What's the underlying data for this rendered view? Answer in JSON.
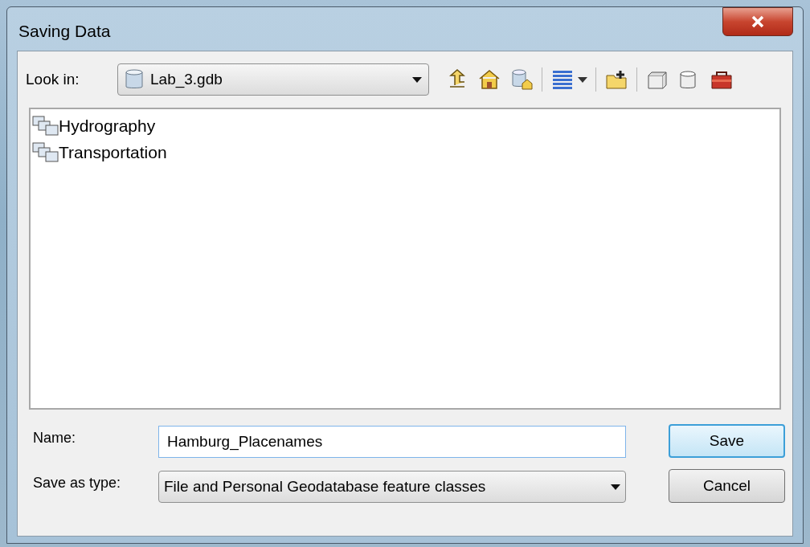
{
  "window": {
    "title": "Saving Data"
  },
  "look_in": {
    "label": "Look in:",
    "value": "Lab_3.gdb"
  },
  "items": [
    {
      "name": "Hydrography"
    },
    {
      "name": "Transportation"
    }
  ],
  "name_field": {
    "label": "Name:",
    "value": "Hamburg_Placenames"
  },
  "type_field": {
    "label": "Save as type:",
    "value": "File and Personal Geodatabase feature classes"
  },
  "buttons": [
    {
      "label": "Save",
      "default": true
    },
    {
      "label": "Cancel",
      "default": false
    }
  ]
}
